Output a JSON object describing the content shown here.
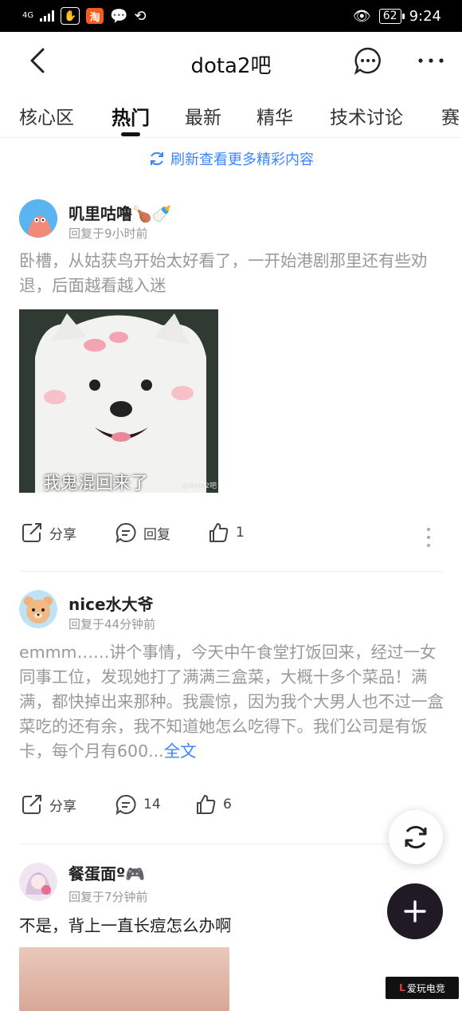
{
  "status_bar": {
    "network": "4G",
    "app_badge": "淘",
    "battery": "62",
    "time": "9:24"
  },
  "header": {
    "title": "dota2吧"
  },
  "tabs": [
    {
      "label": "核心区",
      "active": false
    },
    {
      "label": "热门",
      "active": true
    },
    {
      "label": "最新",
      "active": false
    },
    {
      "label": "精华",
      "active": false
    },
    {
      "label": "技术讨论",
      "active": false
    },
    {
      "label": "赛",
      "active": false
    }
  ],
  "refresh_banner": {
    "label": "刷新查看更多精彩内容"
  },
  "posts": [
    {
      "username": "叽里咕噜",
      "time": "回复于9小时前",
      "text": "卧槽，从姑获鸟开始太好看了，一开始港剧那里还有些劝退，后面越看越入迷",
      "image_caption": "我鬼混回来了",
      "image_watermark": "@dota2吧",
      "share_label": "分享",
      "reply_label": "回复",
      "like_count": "1"
    },
    {
      "username": "nice水大爷",
      "time": "回复于44分钟前",
      "text": "emmm……讲个事情，今天中午食堂打饭回来，经过一女同事工位，发现她打了满满三盒菜，大概十多个菜品！满满，都快掉出来那种。我震惊，因为我个大男人也不过一盒菜吃的还有余，我不知道她怎么吃得下。我们公司是有饭卡，每个月有600...",
      "full_text_label": "全文",
      "share_label": "分享",
      "reply_count": "14",
      "like_count": "6"
    },
    {
      "username": "餐蛋面º",
      "time": "回复于7分钟前",
      "text": "不是，背上一直长痘怎么办啊"
    }
  ],
  "watermark": "爱玩电竞",
  "colors": {
    "accent": "#3b86ff",
    "muted_text": "#999999",
    "fab_dark": "#1f1a25"
  }
}
